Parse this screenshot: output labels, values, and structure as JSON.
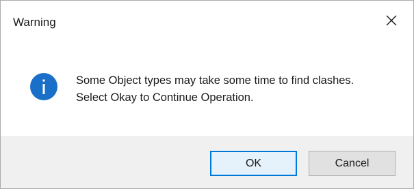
{
  "window": {
    "title": "Warning",
    "close_icon": "close-icon"
  },
  "content": {
    "icon": "info-icon",
    "icon_color": "#1a6fc9",
    "message_lines": [
      "Some Object types may take some time to find clashes.",
      "Select Okay to Continue Operation."
    ]
  },
  "footer": {
    "ok_label": "OK",
    "cancel_label": "Cancel",
    "default_button": "OK",
    "accent_color": "#0078d7"
  }
}
